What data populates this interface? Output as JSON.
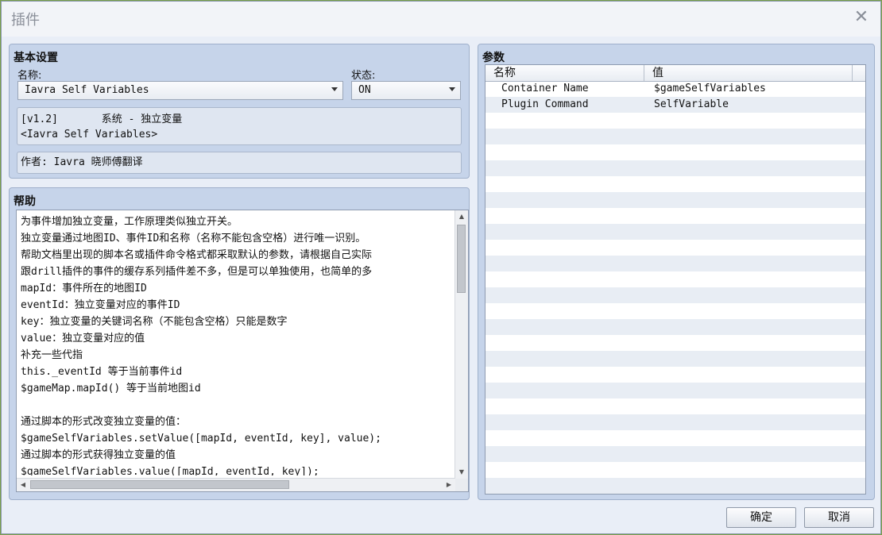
{
  "window": {
    "title": "插件",
    "close_glyph": "✕"
  },
  "basic": {
    "title": "基本设置",
    "name_label": "名称:",
    "name_value": "Iavra Self Variables",
    "status_label": "状态:",
    "status_value": "ON",
    "description_line1": "[v1.2]       系统 - 独立变量",
    "description_line2": "<Iavra Self Variables>",
    "author": "作者: Iavra 晓师傅翻译"
  },
  "help": {
    "title": "帮助",
    "lines": [
      "为事件增加独立变量，工作原理类似独立开关。",
      "独立变量通过地图ID、事件ID和名称（名称不能包含空格）进行唯一识别。",
      "帮助文档里出现的脚本名或插件命令格式都采取默认的参数，请根据自己实际",
      "跟drill插件的事件的缓存系列插件差不多，但是可以单独使用，也简单的多",
      "mapId：事件所在的地图ID",
      "eventId：独立变量对应的事件ID",
      "key：独立变量的关键词名称（不能包含空格）只能是数字",
      "value：独立变量对应的值",
      "补充一些代指",
      "this._eventId 等于当前事件id",
      "$gameMap.mapId() 等于当前地图id",
      "",
      "通过脚本的形式改变独立变量的值：",
      "$gameSelfVariables.setValue([mapId, eventId, key], value);",
      "通过脚本的形式获得独立变量的值",
      "$gameSelfVariables.value([mapId, eventId, key]);"
    ]
  },
  "params": {
    "title": "参数",
    "col_name": "名称",
    "col_value": "值",
    "rows": [
      {
        "name": "Container Name",
        "value": "$gameSelfVariables"
      },
      {
        "name": "Plugin Command",
        "value": "SelfVariable"
      }
    ]
  },
  "buttons": {
    "ok": "确定",
    "cancel": "取消"
  }
}
